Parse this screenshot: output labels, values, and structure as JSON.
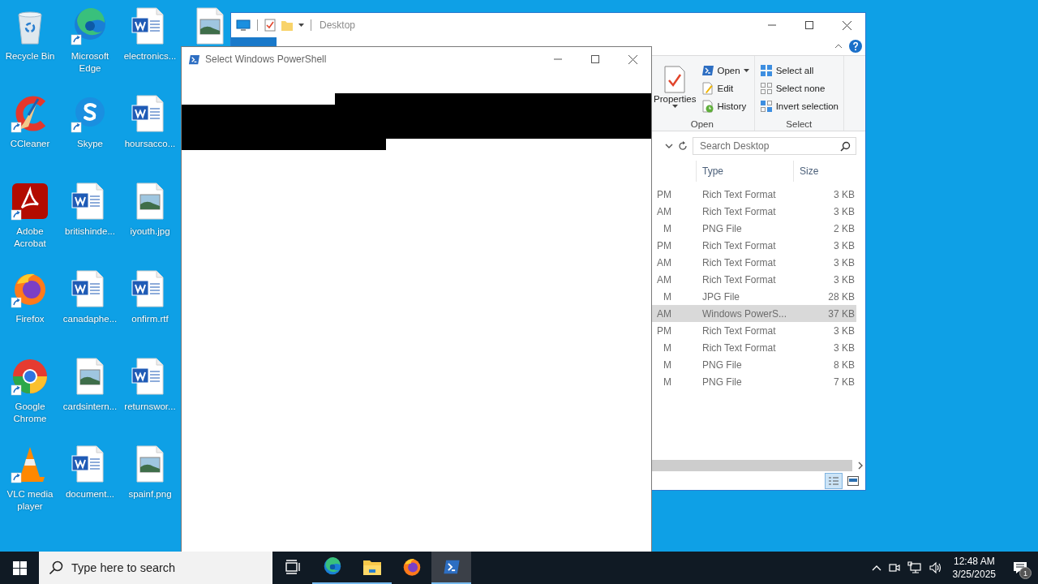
{
  "desktop_icons": [
    {
      "label": "Recycle Bin",
      "kind": "recycle",
      "shortcut": false
    },
    {
      "label": "CCleaner",
      "kind": "ccleaner",
      "shortcut": true
    },
    {
      "label": "Adobe Acrobat",
      "kind": "acrobat",
      "shortcut": true
    },
    {
      "label": "Firefox",
      "kind": "firefox",
      "shortcut": true
    },
    {
      "label": "Google Chrome",
      "kind": "chrome",
      "shortcut": true
    },
    {
      "label": "VLC media player",
      "kind": "vlc",
      "shortcut": true
    },
    {
      "label": "Microsoft Edge",
      "kind": "edge",
      "shortcut": true
    },
    {
      "label": "Skype",
      "kind": "skype",
      "shortcut": true
    },
    {
      "label": "britishinde...",
      "kind": "word",
      "shortcut": false
    },
    {
      "label": "canadaphe...",
      "kind": "word",
      "shortcut": false
    },
    {
      "label": "cardsintern...",
      "kind": "image",
      "shortcut": false
    },
    {
      "label": "document...",
      "kind": "word",
      "shortcut": false
    },
    {
      "label": "electronics...",
      "kind": "word",
      "shortcut": false
    },
    {
      "label": "hoursacco...",
      "kind": "word",
      "shortcut": false
    },
    {
      "label": "iyouth.jpg",
      "kind": "image",
      "shortcut": false
    },
    {
      "label": "onfirm.rtf",
      "kind": "word",
      "shortcut": false
    },
    {
      "label": "returnswor...",
      "kind": "word",
      "shortcut": false
    },
    {
      "label": "spainf.png",
      "kind": "image",
      "shortcut": false
    },
    {
      "kind": "image",
      "shortcut": false
    }
  ],
  "explorer": {
    "title": "Desktop",
    "ribbon": {
      "properties_label": "Properties",
      "open_group": {
        "label": "Open",
        "items": [
          {
            "label": "Open",
            "kind": "open",
            "menu": true
          },
          {
            "label": "Edit",
            "kind": "edit",
            "menu": false
          },
          {
            "label": "History",
            "kind": "history",
            "menu": false
          }
        ]
      },
      "select_group": {
        "label": "Select",
        "items": [
          {
            "label": "Select all",
            "kind": "all"
          },
          {
            "label": "Select none",
            "kind": "none"
          },
          {
            "label": "Invert selection",
            "kind": "invert"
          }
        ]
      }
    },
    "search": {
      "placeholder": "Search Desktop"
    },
    "columns": [
      "Type",
      "Size"
    ],
    "rows": [
      {
        "column_1": "PM",
        "type": "Rich Text Format",
        "size": "3 KB",
        "selected": false
      },
      {
        "column_1": "AM",
        "type": "Rich Text Format",
        "size": "3 KB",
        "selected": false
      },
      {
        "column_1": "M",
        "type": "PNG File",
        "size": "2 KB",
        "selected": false
      },
      {
        "column_1": "PM",
        "type": "Rich Text Format",
        "size": "3 KB",
        "selected": false
      },
      {
        "column_1": "AM",
        "type": "Rich Text Format",
        "size": "3 KB",
        "selected": false
      },
      {
        "column_1": "AM",
        "type": "Rich Text Format",
        "size": "3 KB",
        "selected": false
      },
      {
        "column_1": "M",
        "type": "JPG File",
        "size": "28 KB",
        "selected": false
      },
      {
        "column_1": "AM",
        "type": "Windows PowerS...",
        "size": "37 KB",
        "selected": true
      },
      {
        "column_1": "PM",
        "type": "Rich Text Format",
        "size": "3 KB",
        "selected": false
      },
      {
        "column_1": "M",
        "type": "Rich Text Format",
        "size": "3 KB",
        "selected": false
      },
      {
        "column_1": "M",
        "type": "PNG File",
        "size": "8 KB",
        "selected": false
      },
      {
        "column_1": "M",
        "type": "PNG File",
        "size": "7 KB",
        "selected": false
      }
    ]
  },
  "powershell_window": {
    "title": "Select Windows PowerShell"
  },
  "taskbar": {
    "search": {
      "placeholder": "Type here to search"
    },
    "apps": [
      {
        "kind": "taskview",
        "running": false,
        "selected": false
      },
      {
        "kind": "edge",
        "running": true,
        "selected": false
      },
      {
        "kind": "explorer",
        "running": true,
        "selected": false
      },
      {
        "kind": "firefox",
        "running": false,
        "selected": false
      },
      {
        "kind": "powershell",
        "running": true,
        "selected": true
      }
    ],
    "time": "12:48 AM",
    "date": "3/25/2025",
    "notification_count": "1"
  }
}
